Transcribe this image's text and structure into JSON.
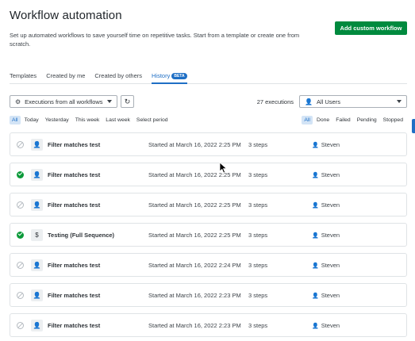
{
  "header": {
    "title": "Workflow automation",
    "description": "Set up automated workflows to save yourself time on repetitive tasks. Start from a template or create one from scratch.",
    "add_button": "Add custom workflow"
  },
  "tabs": [
    {
      "label": "Templates",
      "active": false
    },
    {
      "label": "Created by me",
      "active": false
    },
    {
      "label": "Created by others",
      "active": false
    },
    {
      "label": "History",
      "active": true,
      "badge": "BETA"
    }
  ],
  "toolbar": {
    "executions_select": "Executions from all workflows",
    "executions_count": "27 executions",
    "users_select": "All Users"
  },
  "time_filters": [
    "All",
    "Today",
    "Yesterday",
    "This week",
    "Last week",
    "Select period"
  ],
  "time_filter_active": "All",
  "status_filters": [
    "All",
    "Done",
    "Failed",
    "Pending",
    "Stopped"
  ],
  "status_filter_active": "All",
  "rows": [
    {
      "status": "disabled",
      "icon": "person",
      "name": "Filter matches test",
      "started": "Started at March 16, 2022 2:25 PM",
      "steps": "3 steps",
      "user": "Steven"
    },
    {
      "status": "success",
      "icon": "person",
      "name": "Filter matches test",
      "started": "Started at March 16, 2022 2:25 PM",
      "steps": "3 steps",
      "user": "Steven"
    },
    {
      "status": "disabled",
      "icon": "person",
      "name": "Filter matches test",
      "started": "Started at March 16, 2022 2:25 PM",
      "steps": "3 steps",
      "user": "Steven"
    },
    {
      "status": "success",
      "icon": "dollar",
      "name": "Testing (Full Sequence)",
      "started": "Started at March 16, 2022 2:25 PM",
      "steps": "3 steps",
      "user": "Steven"
    },
    {
      "status": "disabled",
      "icon": "person",
      "name": "Filter matches test",
      "started": "Started at March 16, 2022 2:24 PM",
      "steps": "3 steps",
      "user": "Steven"
    },
    {
      "status": "disabled",
      "icon": "person",
      "name": "Filter matches test",
      "started": "Started at March 16, 2022 2:23 PM",
      "steps": "3 steps",
      "user": "Steven"
    },
    {
      "status": "disabled",
      "icon": "person",
      "name": "Filter matches test",
      "started": "Started at March 16, 2022 2:23 PM",
      "steps": "3 steps",
      "user": "Steven"
    }
  ],
  "colors": {
    "primary_button": "#008a3e",
    "accent": "#1f6fc5",
    "success": "#0c9a3a"
  }
}
